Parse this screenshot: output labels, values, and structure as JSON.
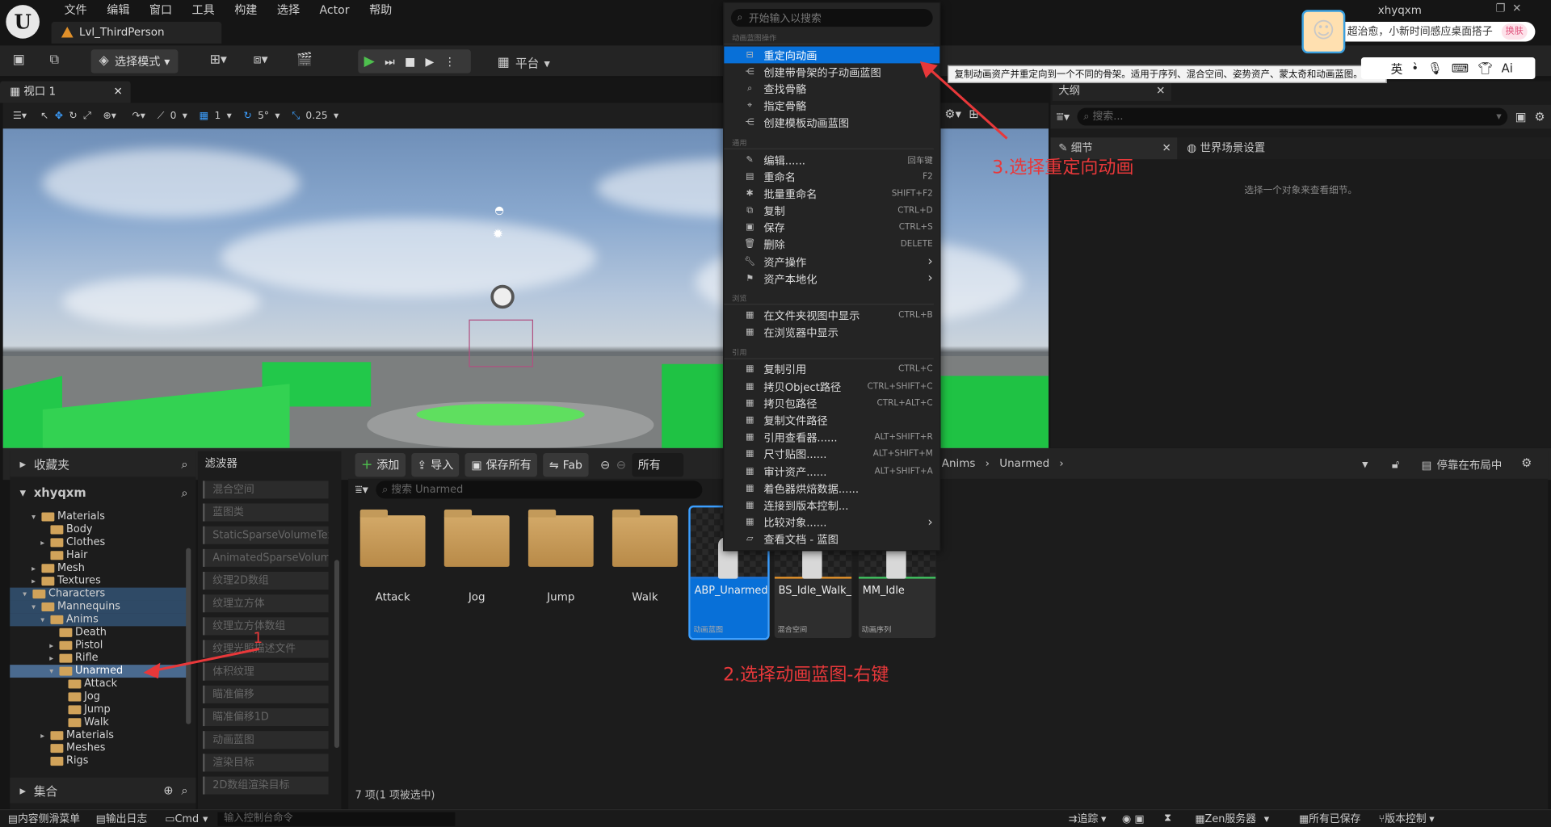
{
  "menubar": {
    "items": [
      "文件",
      "编辑",
      "窗口",
      "工具",
      "构建",
      "选择",
      "Actor",
      "帮助"
    ],
    "user": "xhyqxm"
  },
  "level_tab": "Lvl_ThirdPerson",
  "toolbar": {
    "mode": "选择模式",
    "platform": "平台"
  },
  "viewport": {
    "tab": "视口 1",
    "snap_angle": "0",
    "snap_scale": "1",
    "rot": "5°",
    "scale": "0.25"
  },
  "outliner": {
    "title": "大纲",
    "search_placeholder": "搜索...",
    "details_tab": "细节",
    "world_settings_tab": "世界场景设置",
    "empty_hint": "选择一个对象来查看细节。"
  },
  "content_browser": {
    "favorites": "收藏夹",
    "project": "xhyqxm",
    "collections": "集合",
    "tree": [
      {
        "label": "Materials",
        "depth": 2,
        "arrow": "▾"
      },
      {
        "label": "Body",
        "depth": 3,
        "arrow": ""
      },
      {
        "label": "Clothes",
        "depth": 3,
        "arrow": "▸"
      },
      {
        "label": "Hair",
        "depth": 3,
        "arrow": ""
      },
      {
        "label": "Mesh",
        "depth": 2,
        "arrow": "▸"
      },
      {
        "label": "Textures",
        "depth": 2,
        "arrow": "▸"
      },
      {
        "label": "Characters",
        "depth": 1,
        "arrow": "▾",
        "hl": true
      },
      {
        "label": "Mannequins",
        "depth": 2,
        "arrow": "▾",
        "hl": true
      },
      {
        "label": "Anims",
        "depth": 3,
        "arrow": "▾",
        "hl": true
      },
      {
        "label": "Death",
        "depth": 4,
        "arrow": ""
      },
      {
        "label": "Pistol",
        "depth": 4,
        "arrow": "▸"
      },
      {
        "label": "Rifle",
        "depth": 4,
        "arrow": "▸"
      },
      {
        "label": "Unarmed",
        "depth": 4,
        "arrow": "▾",
        "sel": true
      },
      {
        "label": "Attack",
        "depth": 5,
        "arrow": ""
      },
      {
        "label": "Jog",
        "depth": 5,
        "arrow": ""
      },
      {
        "label": "Jump",
        "depth": 5,
        "arrow": ""
      },
      {
        "label": "Walk",
        "depth": 5,
        "arrow": ""
      },
      {
        "label": "Materials",
        "depth": 3,
        "arrow": "▸"
      },
      {
        "label": "Meshes",
        "depth": 3,
        "arrow": ""
      },
      {
        "label": "Rigs",
        "depth": 3,
        "arrow": ""
      }
    ],
    "filters_title": "滤波器",
    "filters": [
      "混合空间",
      "蓝图类",
      "StaticSparseVolumeTex",
      "AnimatedSparseVolume",
      "纹理2D数组",
      "纹理立方体",
      "纹理立方体数组",
      "纹理光照描述文件",
      "体积纹理",
      "瞄准偏移",
      "瞄准偏移1D",
      "动画蓝图",
      "渲染目标",
      "2D数组渲染目标"
    ],
    "add_btn": "添加",
    "import_btn": "导入",
    "save_all_btn": "保存所有",
    "fab_btn": "Fab",
    "all_btn": "所有",
    "search_placeholder": "搜索 Unarmed",
    "path": [
      "Anims",
      "Unarmed"
    ],
    "dock_btn": "停靠在布局中",
    "folders": [
      "Attack",
      "Jog",
      "Jump",
      "Walk"
    ],
    "assets": [
      {
        "name": "ABP_Unarmed",
        "type": "动画蓝图",
        "selected": true
      },
      {
        "name": "BS_Idle_Walk_Run",
        "type": "混合空间",
        "selected": false
      },
      {
        "name": "MM_Idle",
        "type": "动画序列",
        "selected": false
      }
    ],
    "count": "7 项(1 项被选中)"
  },
  "context_menu": {
    "search_placeholder": "开始输入以搜索",
    "sections": [
      {
        "title": "动画蓝图操作",
        "items": [
          {
            "label": "重定向动画",
            "sc": "",
            "active": true
          },
          {
            "label": "创建带骨架的子动画蓝图",
            "sc": ""
          },
          {
            "label": "查找骨骼",
            "sc": ""
          },
          {
            "label": "指定骨骼",
            "sc": ""
          },
          {
            "label": "创建模板动画蓝图",
            "sc": ""
          }
        ]
      },
      {
        "title": "通用",
        "items": [
          {
            "label": "编辑......",
            "sc": "回车键"
          },
          {
            "label": "重命名",
            "sc": "F2"
          },
          {
            "label": "批量重命名",
            "sc": "SHIFT+F2"
          },
          {
            "label": "复制",
            "sc": "CTRL+D"
          },
          {
            "label": "保存",
            "sc": "CTRL+S"
          },
          {
            "label": "删除",
            "sc": "DELETE"
          },
          {
            "label": "资产操作",
            "sc": "›"
          },
          {
            "label": "资产本地化",
            "sc": "›"
          }
        ]
      },
      {
        "title": "浏览",
        "items": [
          {
            "label": "在文件夹视图中显示",
            "sc": "CTRL+B"
          },
          {
            "label": "在浏览器中显示",
            "sc": ""
          }
        ]
      },
      {
        "title": "引用",
        "items": [
          {
            "label": "复制引用",
            "sc": "CTRL+C"
          },
          {
            "label": "拷贝Object路径",
            "sc": "CTRL+SHIFT+C"
          },
          {
            "label": "拷贝包路径",
            "sc": "CTRL+ALT+C"
          },
          {
            "label": "复制文件路径",
            "sc": ""
          },
          {
            "label": "引用查看器......",
            "sc": "ALT+SHIFT+R"
          },
          {
            "label": "尺寸贴图......",
            "sc": "ALT+SHIFT+M"
          },
          {
            "label": "审计资产......",
            "sc": "ALT+SHIFT+A"
          },
          {
            "label": "着色器烘焙数据......",
            "sc": ""
          },
          {
            "label": "连接到版本控制...",
            "sc": ""
          },
          {
            "label": "比较对象......",
            "sc": "›"
          },
          {
            "label": "查看文档 - 蓝图",
            "sc": ""
          }
        ]
      }
    ]
  },
  "tooltip": "复制动画资产并重定向到一个不同的骨架。适用于序列、混合空间、姿势资产、蒙太奇和动画蓝图。",
  "annotations": {
    "step1": "1",
    "step2": "2.选择动画蓝图-右键",
    "step3": "3.选择重定向动画"
  },
  "ime": {
    "text": "超治愈，小新时间感应桌面搭子",
    "btn": "换肤",
    "lang": "英"
  },
  "statusbar": {
    "drawer": "内容侧滑菜单",
    "log": "输出日志",
    "cmd": "Cmd",
    "cmd_placeholder": "输入控制台命令",
    "trace": "追踪",
    "zen": "Zen服务器",
    "saved": "所有已保存",
    "vc": "版本控制"
  },
  "colors": {
    "accent": "#0870d8",
    "annotation": "#e8383a",
    "folder": "#d1a35a"
  }
}
